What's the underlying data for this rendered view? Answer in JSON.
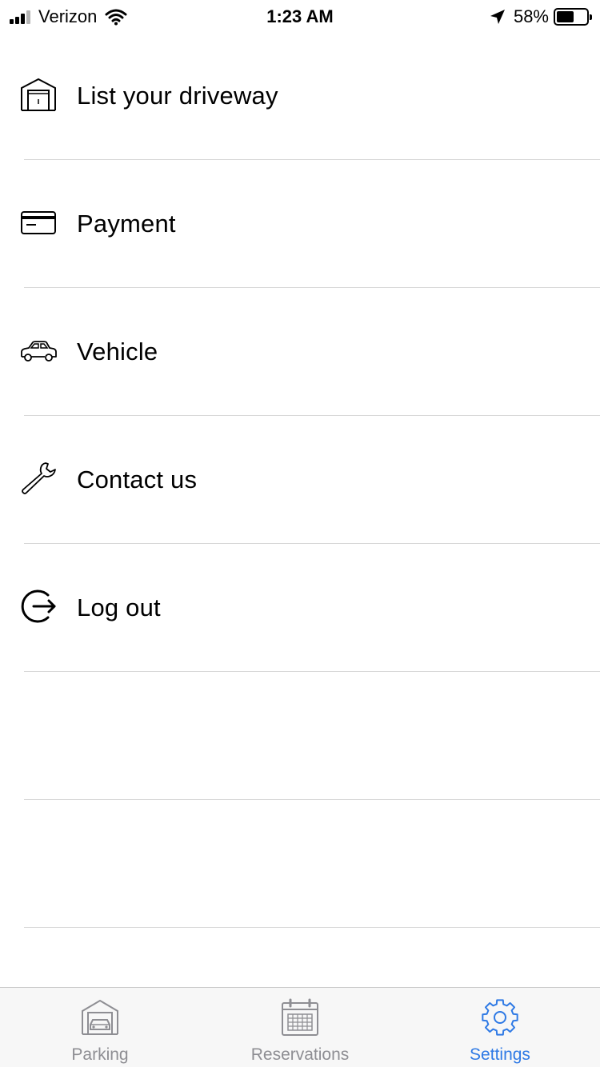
{
  "status_bar": {
    "carrier": "Verizon",
    "time": "1:23 AM",
    "battery_percent": "58%",
    "battery_level": 0.58
  },
  "menu": {
    "items": [
      {
        "label": "List your driveway",
        "icon": "garage-icon"
      },
      {
        "label": "Payment",
        "icon": "credit-card-icon"
      },
      {
        "label": "Vehicle",
        "icon": "car-icon"
      },
      {
        "label": "Contact us",
        "icon": "wrench-icon"
      },
      {
        "label": "Log out",
        "icon": "logout-icon"
      },
      {
        "label": "",
        "icon": ""
      },
      {
        "label": "",
        "icon": ""
      }
    ]
  },
  "tab_bar": {
    "tabs": [
      {
        "label": "Parking",
        "icon": "garage-car-icon",
        "active": false
      },
      {
        "label": "Reservations",
        "icon": "calendar-icon",
        "active": false
      },
      {
        "label": "Settings",
        "icon": "gear-icon",
        "active": true
      }
    ]
  },
  "colors": {
    "accent": "#2f7ae5",
    "inactive_tab": "#8e8e93",
    "divider": "#d8d8d8",
    "tab_bar_bg": "#f7f7f7"
  }
}
